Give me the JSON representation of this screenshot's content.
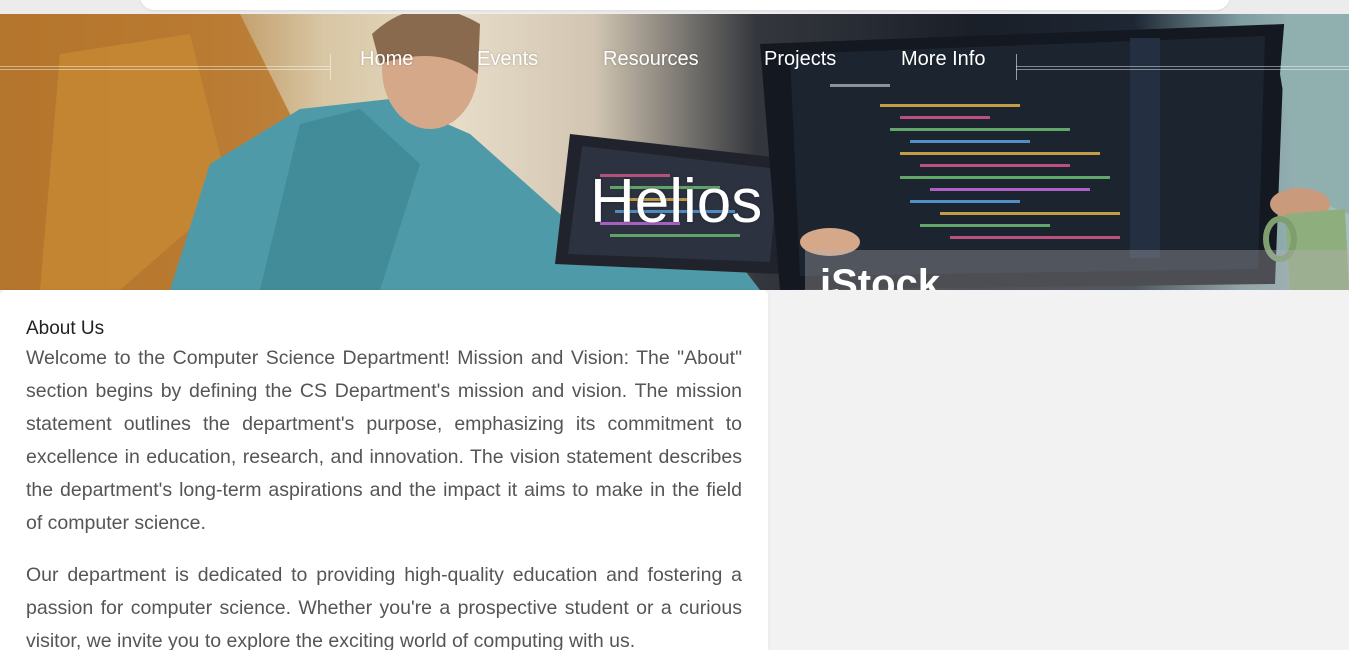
{
  "nav": {
    "items": [
      {
        "label": "Home"
      },
      {
        "label": "Events"
      },
      {
        "label": "Resources"
      },
      {
        "label": "Projects"
      },
      {
        "label": "More Info"
      }
    ]
  },
  "hero": {
    "title": "Helios",
    "watermark": "iStock"
  },
  "about": {
    "heading": "About Us",
    "paragraphs": [
      "Welcome to the Computer Science Department! Mission and Vision: The \"About\" section begins by defining the CS Department's mission and vision. The mission statement outlines the department's purpose, emphasizing its commitment to excellence in education, research, and innovation. The vision statement describes the department's long-term aspirations and the impact it aims to make in the field of computer science.",
      "Our department is dedicated to providing high-quality education and fostering a passion for computer science. Whether you're a prospective student or a curious visitor, we invite you to explore the exciting world of computing with us."
    ]
  },
  "colors": {
    "page_background": "#f2f2f2",
    "card_background": "#ffffff",
    "body_text": "#555555",
    "heading_text": "#222222",
    "nav_text": "#ffffff"
  }
}
